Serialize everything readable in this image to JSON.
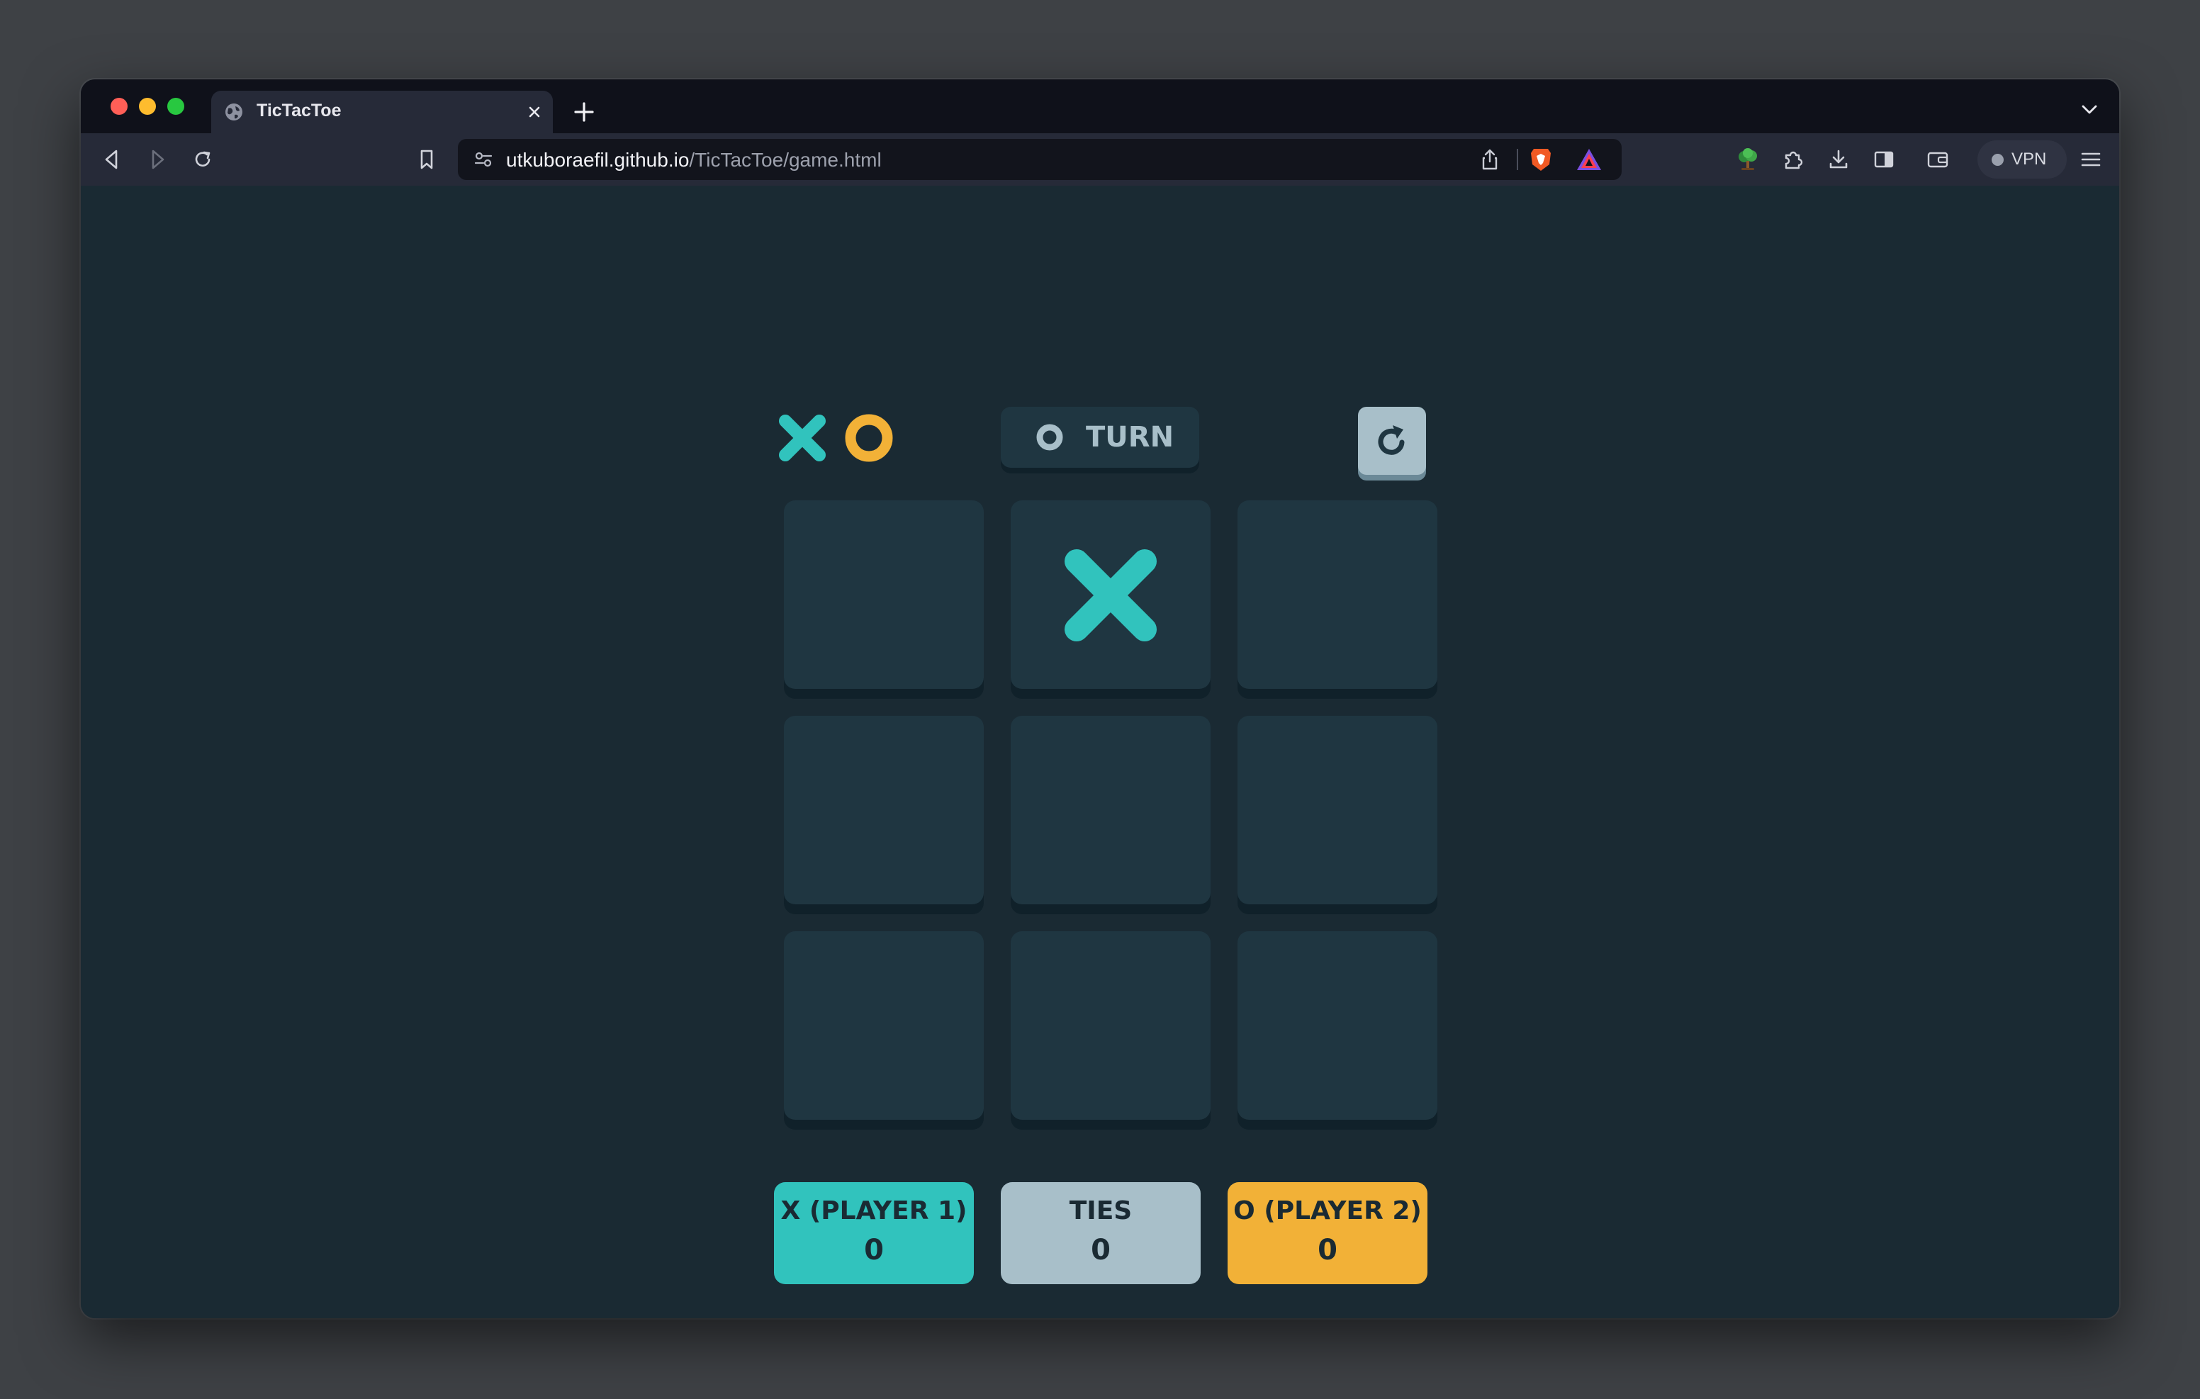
{
  "browser": {
    "tab": {
      "title": "TicTacToe"
    },
    "url": {
      "host": "utkuboraefil.github.io",
      "path": "/TicTacToe/game.html"
    },
    "vpn_label": "VPN"
  },
  "game": {
    "turn": {
      "mark": "O",
      "label": "TURN"
    },
    "board": [
      [
        "",
        "X",
        ""
      ],
      [
        "",
        "",
        ""
      ],
      [
        "",
        "",
        ""
      ]
    ],
    "scores": {
      "x": {
        "label": "X (PLAYER 1)",
        "value": "0"
      },
      "ties": {
        "label": "TIES",
        "value": "0"
      },
      "o": {
        "label": "O (PLAYER 2)",
        "value": "0"
      }
    },
    "colors": {
      "x": "#31c3bd",
      "o": "#f2b137",
      "ties": "#a8bfc9",
      "cell": "#1f3641",
      "background": "#1a2a33"
    }
  }
}
